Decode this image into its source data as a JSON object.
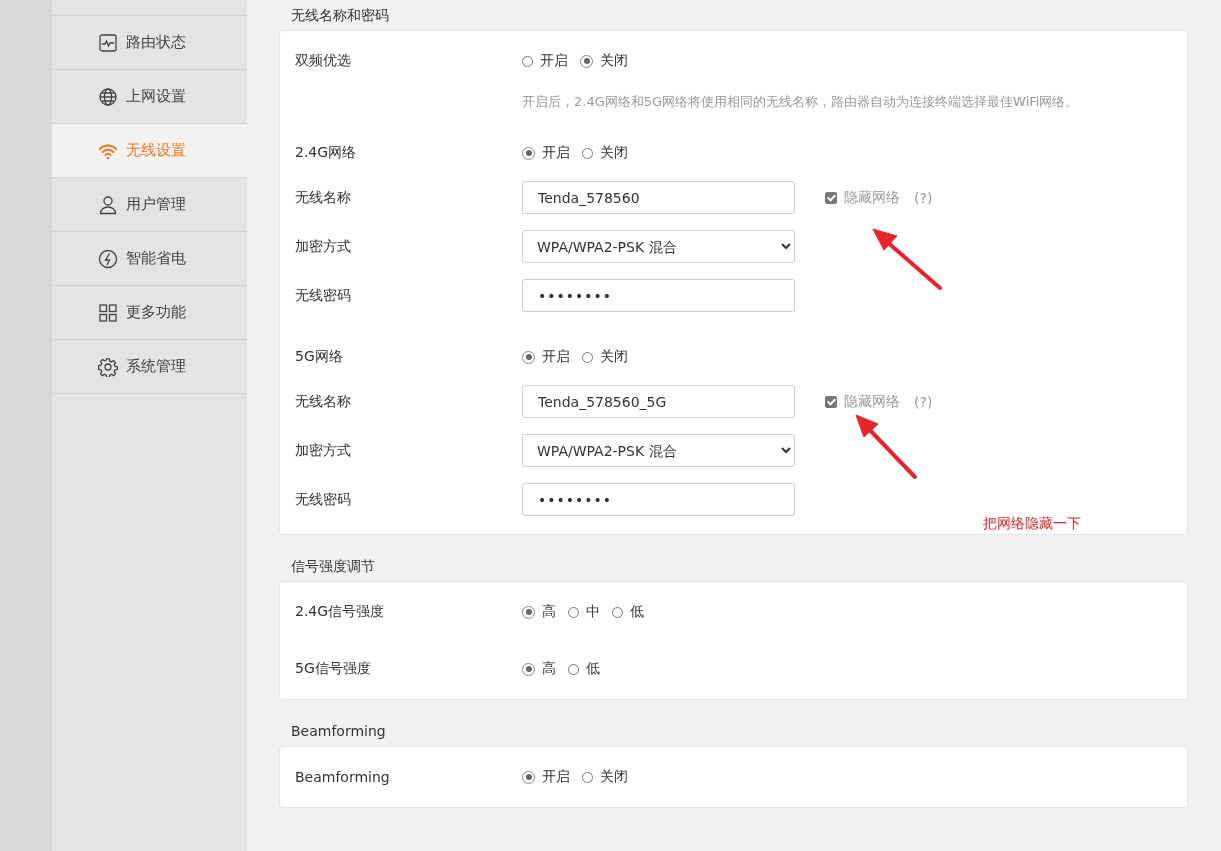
{
  "sidebar": {
    "items": [
      {
        "label": "路由状态",
        "selected": false
      },
      {
        "label": "上网设置",
        "selected": false
      },
      {
        "label": "无线设置",
        "selected": true
      },
      {
        "label": "用户管理",
        "selected": false
      },
      {
        "label": "智能省电",
        "selected": false
      },
      {
        "label": "更多功能",
        "selected": false
      },
      {
        "label": "系统管理",
        "selected": false
      }
    ]
  },
  "sections": [
    {
      "title": "无线名称和密码",
      "groups": [
        [
          {
            "kind": "radio",
            "label": "双频优选",
            "options": [
              {
                "label": "开启",
                "selected": false
              },
              {
                "label": "关闭",
                "selected": true
              }
            ],
            "hint": "开启后，2.4G网络和5G网络将使用相同的无线名称，路由器自动为连接终端选择最佳WiFi网络。"
          }
        ],
        [
          {
            "kind": "radio",
            "label": "2.4G网络",
            "options": [
              {
                "label": "开启",
                "selected": true
              },
              {
                "label": "关闭",
                "selected": false
              }
            ]
          },
          {
            "kind": "text",
            "label": "无线名称",
            "value": "Tenda_578560",
            "hide": {
              "label": "隐藏网络",
              "checked": true,
              "help": "(?)"
            }
          },
          {
            "kind": "select",
            "label": "加密方式",
            "value": "WPA/WPA2-PSK 混合"
          },
          {
            "kind": "password",
            "label": "无线密码",
            "value": "••••••••"
          }
        ],
        [
          {
            "kind": "radio",
            "label": "5G网络",
            "options": [
              {
                "label": "开启",
                "selected": true
              },
              {
                "label": "关闭",
                "selected": false
              }
            ]
          },
          {
            "kind": "text",
            "label": "无线名称",
            "value": "Tenda_578560_5G",
            "hide": {
              "label": "隐藏网络",
              "checked": true,
              "help": "(?)"
            }
          },
          {
            "kind": "select",
            "label": "加密方式",
            "value": "WPA/WPA2-PSK 混合"
          },
          {
            "kind": "password",
            "label": "无线密码",
            "value": "••••••••"
          }
        ]
      ]
    },
    {
      "title": "信号强度调节",
      "groups": [
        [
          {
            "kind": "radio",
            "label": "2.4G信号强度",
            "options": [
              {
                "label": "高",
                "selected": true
              },
              {
                "label": "中",
                "selected": false
              },
              {
                "label": "低",
                "selected": false
              }
            ]
          },
          {
            "kind": "radio",
            "label": "5G信号强度",
            "options": [
              {
                "label": "高",
                "selected": true
              },
              {
                "label": "低",
                "selected": false
              }
            ]
          }
        ]
      ]
    },
    {
      "title": "Beamforming",
      "groups": [
        [
          {
            "kind": "radio",
            "label": "Beamforming",
            "options": [
              {
                "label": "开启",
                "selected": true
              },
              {
                "label": "关闭",
                "selected": false
              }
            ]
          }
        ]
      ]
    }
  ],
  "annotation": {
    "text": "把网络隐藏一下"
  }
}
